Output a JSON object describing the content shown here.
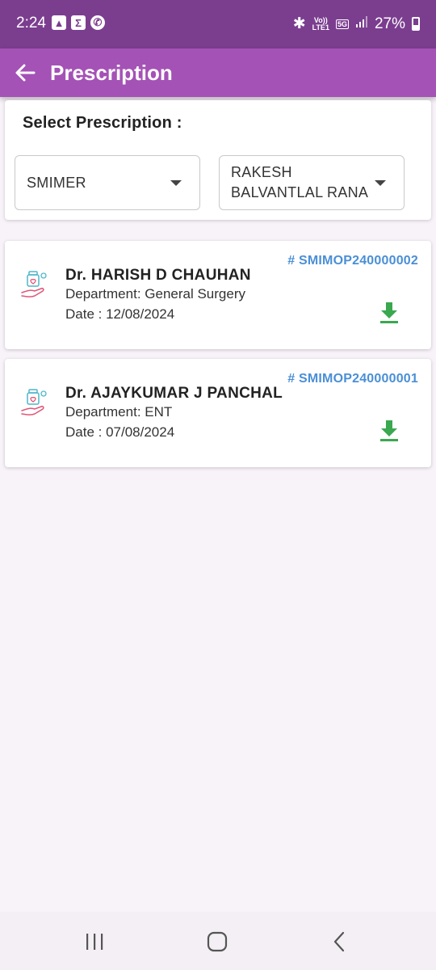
{
  "status": {
    "time": "2:24",
    "volte_top": "Vo))",
    "volte_bottom": "LTE1",
    "network": "5G",
    "battery": "27%"
  },
  "header": {
    "title": "Prescription"
  },
  "select": {
    "title": "Select Prescription  :",
    "hospital": "SMIMER",
    "patient": "RAKESH BALVANTLAL RANA"
  },
  "prescriptions": [
    {
      "id": "# SMIMOP240000002",
      "doctor": "Dr. HARISH D CHAUHAN",
      "department": "Department: General Surgery",
      "date": "Date : 12/08/2024"
    },
    {
      "id": "# SMIMOP240000001",
      "doctor": "Dr. AJAYKUMAR J PANCHAL",
      "department": "Department: ENT",
      "date": "Date : 07/08/2024"
    }
  ],
  "colors": {
    "status_bar": "#7b3e8f",
    "app_bar": "#a452b6",
    "rx_id": "#4a8fd6",
    "download": "#3aa84f",
    "background": "#f8f2f9"
  },
  "icons": {
    "back": "arrow-left-icon",
    "rx": "medicine-hand-icon",
    "download": "download-icon"
  }
}
